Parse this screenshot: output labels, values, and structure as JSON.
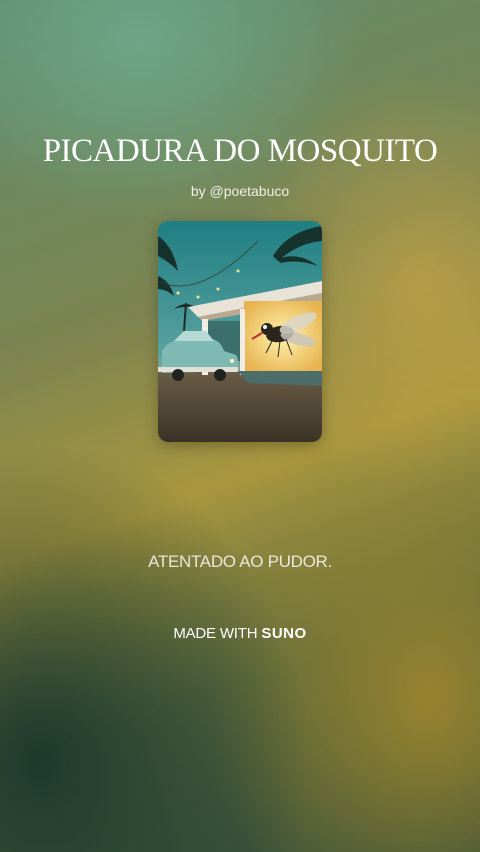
{
  "song": {
    "title": "PICADURA DO MOSQUITO",
    "byline": "by @poetabuco",
    "tagline": "ATENTADO AO PUDOR."
  },
  "footer": {
    "made_with": "MADE WITH",
    "brand": "SUNO"
  },
  "cover_art": {
    "description_icon": "cover-art-image"
  },
  "colors": {
    "title": "#ffffff",
    "text": "#f4f1e6"
  }
}
